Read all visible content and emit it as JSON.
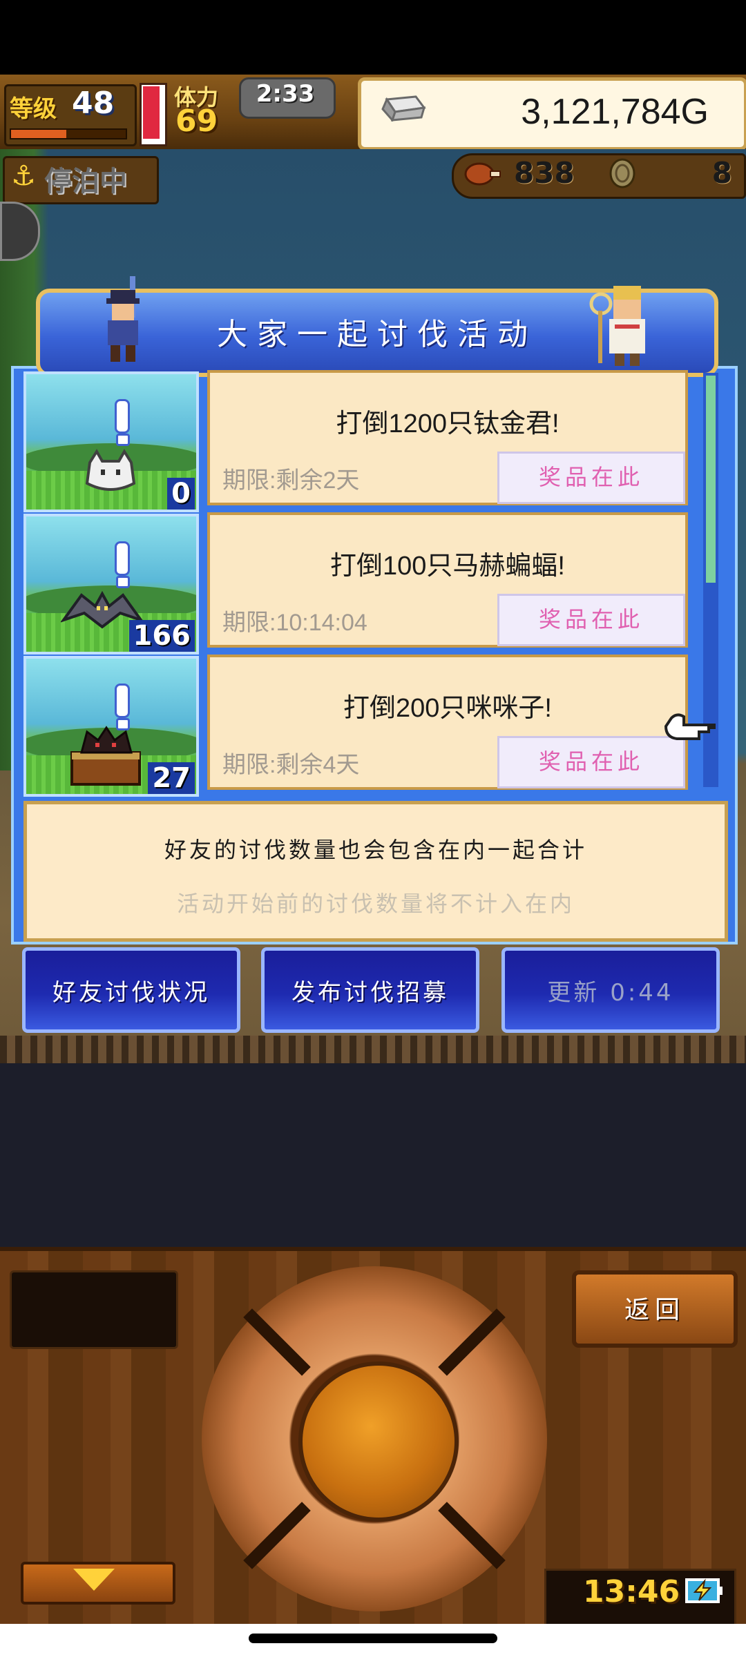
{
  "hud": {
    "level_label": "等级",
    "level": "48",
    "stamina_label": "体力",
    "stamina": "69",
    "timer": "2:33",
    "gold": "3,121,784G",
    "docked_status": "停泊中",
    "meat_count": "838",
    "coin_count": "8"
  },
  "event": {
    "title": "大家一起讨伐活动",
    "tasks": [
      {
        "kill_count": "0",
        "text": "打倒1200只钛金君!",
        "deadline": "期限:剩余2天",
        "reward_label": "奖品在此"
      },
      {
        "kill_count": "166",
        "text": "打倒100只马赫蝙蝠!",
        "deadline": "期限:10:14:04",
        "reward_label": "奖品在此"
      },
      {
        "kill_count": "27",
        "text": "打倒200只咪咪子!",
        "deadline": "期限:剩余4天",
        "reward_label": "奖品在此"
      }
    ],
    "note_main": "好友的讨伐数量也会包含在内一起合计",
    "note_sub": "活动开始前的讨伐数量将不计入在内"
  },
  "actions": {
    "friend_status": "好友讨伐状况",
    "post_recruit": "发布讨伐招募",
    "refresh": "更新 0:44"
  },
  "console": {
    "back": "返回",
    "clock": "13:46"
  },
  "icons": [
    "anchor-icon",
    "silver-ingot-icon",
    "meat-icon",
    "coin-icon",
    "hand-pointer-icon",
    "down-arrow-icon",
    "battery-charging-icon"
  ],
  "colors": {
    "dialog_blue": "#3a78e8",
    "card_bg": "#fbe8c4",
    "reward_pink": "#e060b0",
    "gold_text": "#ffd23a"
  }
}
